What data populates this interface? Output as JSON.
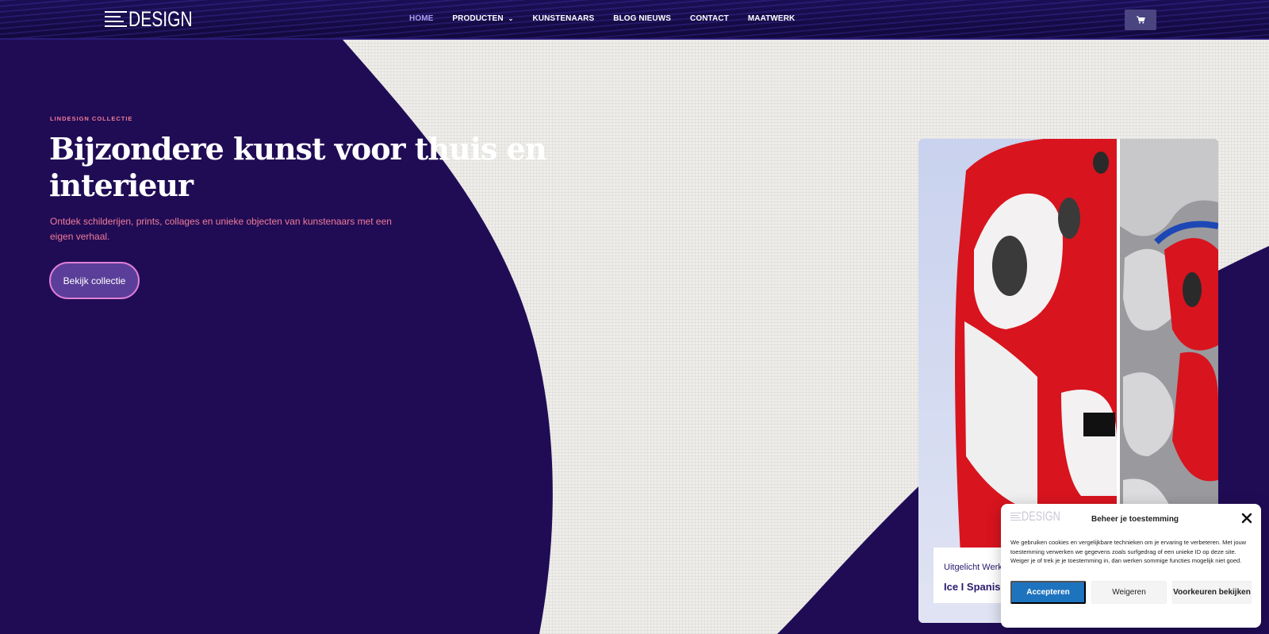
{
  "header": {
    "logo_text": "DESIGN",
    "nav": [
      {
        "label": "HOME",
        "active": true
      },
      {
        "label": "PRODUCTEN",
        "has_dropdown": true
      },
      {
        "label": "KUNSTENAARS"
      },
      {
        "label": "BLOG NIEUWS"
      },
      {
        "label": "CONTACT"
      },
      {
        "label": "MAATWERK"
      }
    ],
    "cart_icon": "cart-icon"
  },
  "hero": {
    "eyebrow": "LINDESIGN COLLECTIE",
    "title": "Bijzondere kunst voor thuis en interieur",
    "subtitle": "Ontdek schilderijen, prints, collages en unieke objecten van kunstenaars met een eigen verhaal.",
    "cta_label": "Bekijk collectie"
  },
  "featured": {
    "label": "Uitgelicht Werk",
    "title": "Ice I Spanish"
  },
  "cookie": {
    "logo_text": "DESIGN",
    "title": "Beheer je toestemming",
    "text": "We gebruiken cookies en vergelijkbare technieken om je ervaring te verbeteren. Met jouw toestemming verwerken we gegevens zoals surfgedrag of een unieke ID op deze site. Weiger je of trek je je toestemming in, dan werken sommige functies mogelijk niet goed.",
    "accept_label": "Accepteren",
    "deny_label": "Weigeren",
    "prefs_label": "Voorkeuren bekijken"
  },
  "colors": {
    "primary_purple": "#200c55",
    "header_bg": "#150b45",
    "accent_pink": "#f07c98",
    "nav_active": "#a99cf2",
    "cookie_accept": "#1e73be"
  }
}
